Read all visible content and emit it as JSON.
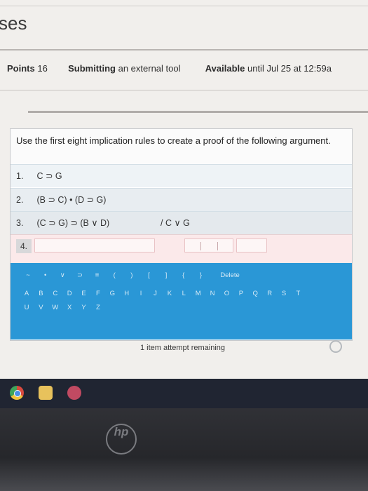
{
  "page": {
    "title": "ses"
  },
  "meta": {
    "points_label": "Points",
    "points_value": "16",
    "submitting_label": "Submitting",
    "submitting_value": "an external tool",
    "available_label": "Available",
    "available_value": "until Jul 25 at 12:59a"
  },
  "question": {
    "prompt": "Use the first eight implication rules to create a proof of the following argument.",
    "lines": [
      {
        "number": "1.",
        "statement": "C ⊃ G",
        "justification": ""
      },
      {
        "number": "2.",
        "statement": "(B ⊃ C) • (D ⊃ G)",
        "justification": ""
      },
      {
        "number": "3.",
        "statement": "(C ⊃ G) ⊃ (B ∨ D)",
        "justification": "/ C ∨ G"
      }
    ],
    "new_line_number": "4."
  },
  "keyboard": {
    "symbols": [
      "~",
      "•",
      "∨",
      "⊃",
      "≡",
      "(",
      ")",
      "[",
      "]",
      "{",
      "}"
    ],
    "delete_label": "Delete",
    "letters_row1": [
      "A",
      "B",
      "C",
      "D",
      "E",
      "F",
      "G",
      "H",
      "I",
      "J",
      "K",
      "L",
      "M",
      "N",
      "O",
      "P",
      "Q",
      "R",
      "S",
      "T"
    ],
    "letters_row2": [
      "U",
      "V",
      "W",
      "X",
      "Y",
      "Z"
    ]
  },
  "attempts_text": "1 item attempt remaining",
  "taskbar": {
    "icons": [
      "chrome-icon",
      "folder-icon",
      "app-icon"
    ]
  },
  "bezel": {
    "logo_text": "hp"
  },
  "colors": {
    "keyboard_bg": "#2a97d6",
    "error_row_bg": "#fbe9ea",
    "taskbar_bg": "#202532"
  }
}
